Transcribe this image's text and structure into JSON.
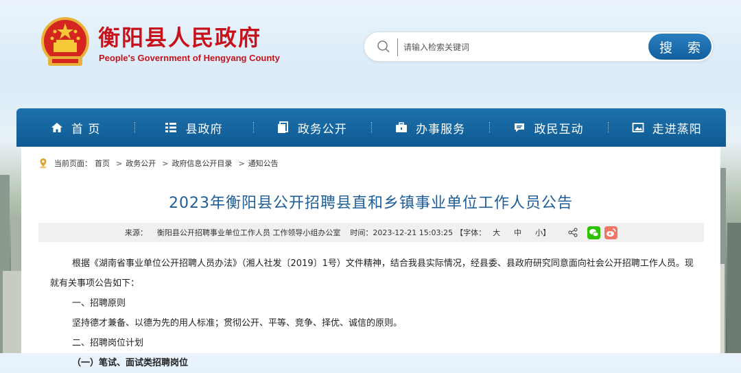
{
  "header": {
    "title": "衡阳县人民政府",
    "subtitle": "People's Government of Hengyang County"
  },
  "search": {
    "placeholder": "请输入检索关键词",
    "button_label": "搜 索"
  },
  "nav": {
    "items": [
      {
        "label": "首 页",
        "icon": "home-icon"
      },
      {
        "label": "县政府",
        "icon": "list-icon"
      },
      {
        "label": "政务公开",
        "icon": "document-icon"
      },
      {
        "label": "办事服务",
        "icon": "briefcase-icon"
      },
      {
        "label": "政民互动",
        "icon": "chat-icon"
      },
      {
        "label": "走进蒸阳",
        "icon": "picture-icon"
      }
    ]
  },
  "breadcrumb": {
    "prefix": "当前页面：",
    "items": [
      "首页",
      "政务公开",
      "政府信息公开目录",
      "通知公告"
    ],
    "separator": ">"
  },
  "article": {
    "title": "2023年衡阳县公开招聘县直和乡镇事业单位工作人员公告",
    "meta": {
      "source_label": "来源：",
      "source": "衡阳县公开招聘事业单位工作人员 工作领导小组办公室",
      "time_label": "时间：",
      "time": "2023-12-21 15:03:25",
      "font_label": "【字体：",
      "size_large": "大",
      "size_medium": "中",
      "size_small": "小】"
    },
    "paragraphs": [
      "根据《湖南省事业单位公开招聘人员办法》（湘人社发〔2019〕1号）文件精神，结合我县实际情况，经县委、县政府研究同意面向社会公开招聘工作人员。现就有关事项公告如下：",
      "一、招聘原则",
      "坚持德才兼备、以德为先的用人标准；贯彻公开、平等、竞争、择优、诚信的原则。",
      "二、招聘岗位计划",
      "（一）笔试、面试类招聘岗位"
    ]
  },
  "colors": {
    "brand_red": "#c8121b",
    "nav_blue": "#1467a3",
    "title_blue": "#1d5d98"
  }
}
